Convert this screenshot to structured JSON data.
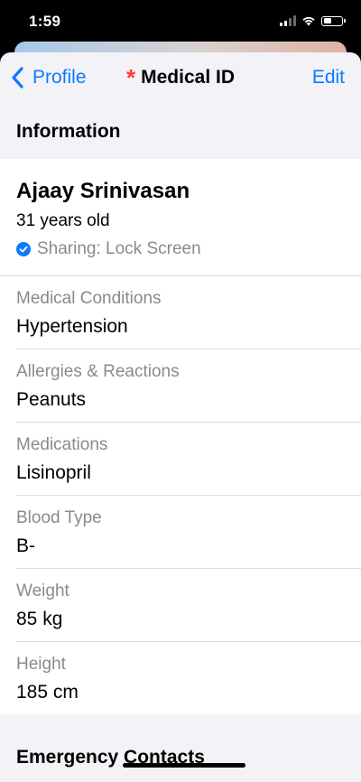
{
  "status_bar": {
    "time": "1:59"
  },
  "nav": {
    "back_label": "Profile",
    "title": "Medical ID",
    "edit_label": "Edit",
    "star": "*"
  },
  "section_header": "Information",
  "profile": {
    "name": "Ajaay Srinivasan",
    "age": "31 years old",
    "sharing": "Sharing: Lock Screen"
  },
  "fields": [
    {
      "label": "Medical Conditions",
      "value": "Hypertension"
    },
    {
      "label": "Allergies & Reactions",
      "value": "Peanuts"
    },
    {
      "label": "Medications",
      "value": "Lisinopril"
    },
    {
      "label": "Blood Type",
      "value": "B-"
    },
    {
      "label": "Weight",
      "value": "85 kg"
    },
    {
      "label": "Height",
      "value": "185 cm"
    }
  ],
  "emergency_header": "Emergency Contacts",
  "colors": {
    "accent": "#0a7aff",
    "star": "#ff3b30",
    "secondary_text": "#8a8a8e",
    "background": "#f2f2f7"
  }
}
